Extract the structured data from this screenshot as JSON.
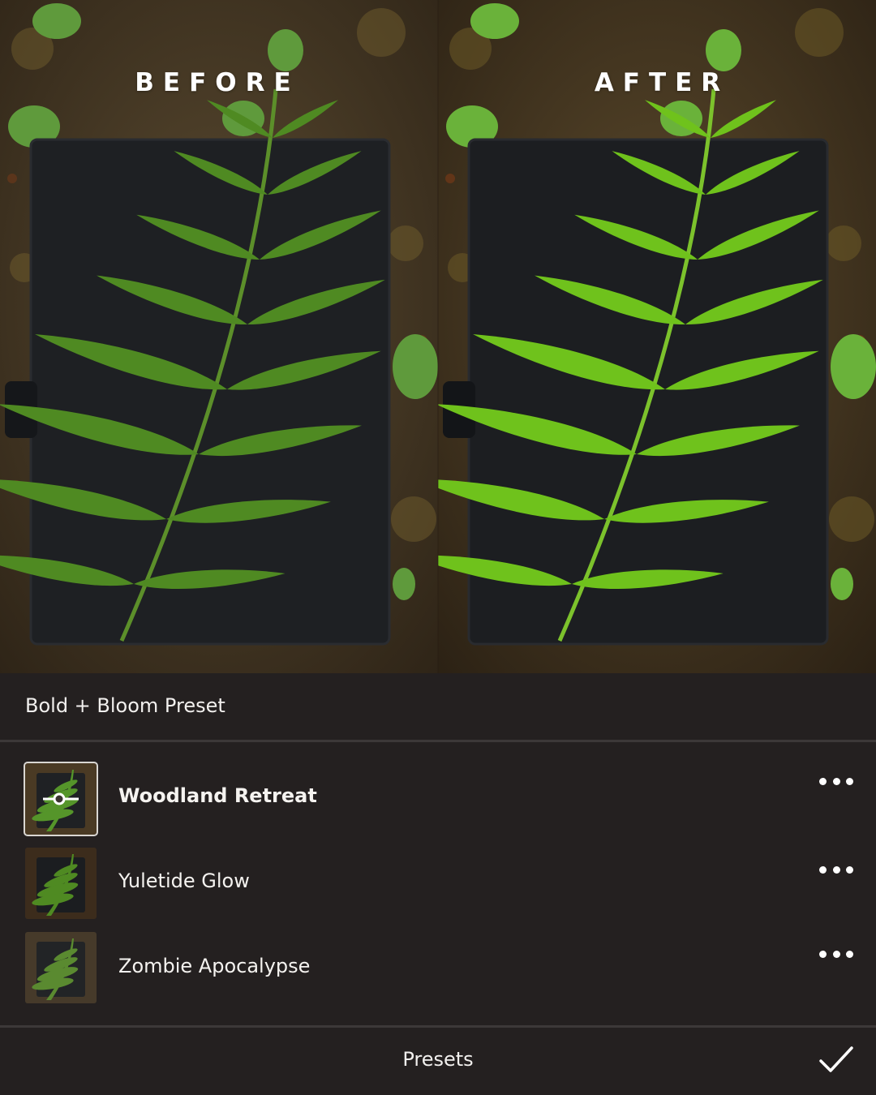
{
  "comparison": {
    "before_label": "BEFORE",
    "after_label": "AFTER"
  },
  "panel": {
    "group_title": "Bold + Bloom Preset",
    "presets": [
      {
        "name": "Woodland Retreat",
        "selected": true
      },
      {
        "name": "Yuletide Glow",
        "selected": false
      },
      {
        "name": "Zombie Apocalypse",
        "selected": false
      }
    ]
  },
  "bottom_bar": {
    "title": "Presets"
  },
  "icons": {
    "more": "more-horizontal-icon",
    "confirm": "checkmark-icon",
    "adjust": "slider-adjust-icon"
  },
  "colors": {
    "panel_background": "#242020",
    "divider": "#3c3838",
    "text": "#f5f3f0",
    "fern_before": "#4f8a22",
    "fern_after": "#6fc21c",
    "notebook": "#1e2023",
    "forest_floor": "#4a3a24"
  }
}
